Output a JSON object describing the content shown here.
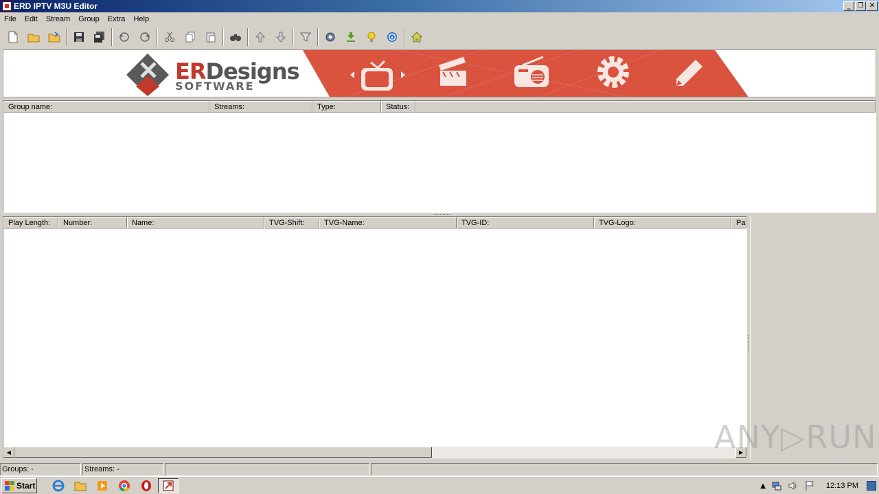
{
  "window": {
    "title": "ERD IPTV M3U Editor",
    "min": "_",
    "restore": "❐",
    "close": "✕"
  },
  "menu": [
    "File",
    "Edit",
    "Stream",
    "Group",
    "Extra",
    "Help"
  ],
  "toolbar_groups": [
    [
      "new-file-icon",
      "open-folder-icon",
      "open-folder-alt-icon"
    ],
    [
      "save-icon",
      "save-all-icon"
    ],
    [
      "undo-icon",
      "redo-icon"
    ],
    [
      "cut-icon",
      "copy-icon",
      "paste-icon"
    ],
    [
      "find-icon"
    ],
    [
      "move-up-icon",
      "move-down-icon"
    ],
    [
      "filter-icon"
    ],
    [
      "settings-icon",
      "download-icon",
      "lightbulb-icon",
      "info-icon"
    ],
    [
      "home-icon"
    ]
  ],
  "banner": {
    "brand_er": "ER",
    "brand_designs": "Designs",
    "brand_sub": "SOFTWARE",
    "ribbon_color": "#d9533f"
  },
  "groups_table": {
    "columns": [
      "Group name:",
      "Streams:",
      "Type:",
      "Status:"
    ]
  },
  "streams_table": {
    "columns": [
      "Play Length:",
      "Number:",
      "Name:",
      "TVG-Shift:",
      "TVG-Name:",
      "TVG-ID:",
      "TVG-Logo:",
      "Pa"
    ]
  },
  "status": {
    "groups": "Groups: -",
    "streams": "Streams: -"
  },
  "taskbar": {
    "start_label": "Start",
    "clock": "12:13 PM"
  },
  "watermark": "ANY▷RUN"
}
